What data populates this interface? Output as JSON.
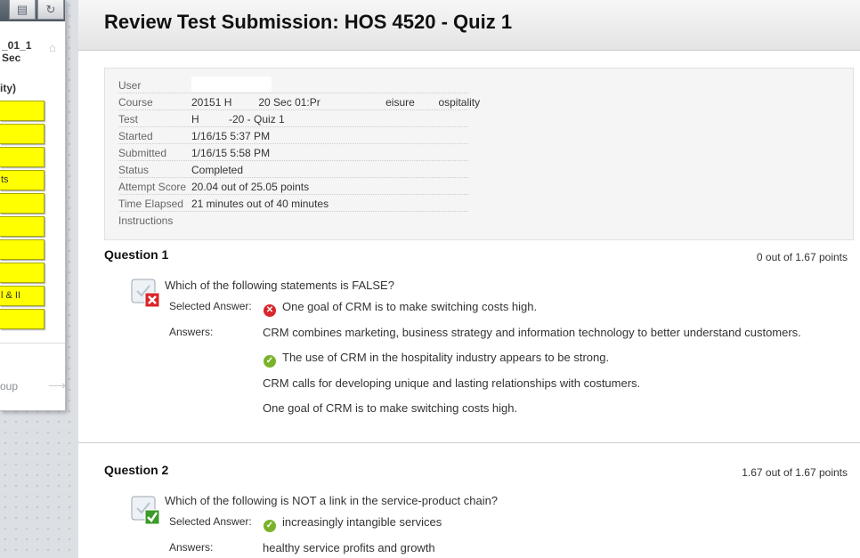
{
  "menu": {
    "course_title_line1": "_01_1",
    "course_title_line2": "Sec",
    "course_sub": "ity)",
    "buttons": [
      {
        "label": ""
      },
      {
        "label": ""
      },
      {
        "label": ""
      },
      {
        "label": "ts"
      },
      {
        "label": ""
      },
      {
        "label": ""
      },
      {
        "label": ""
      },
      {
        "label": ""
      },
      {
        "label": "l & II"
      },
      {
        "label": ""
      }
    ],
    "group_label": "oup"
  },
  "page": {
    "title": "Review Test Submission: HOS 4520 - Quiz 1"
  },
  "summary": {
    "rows": [
      {
        "label": "User",
        "value": ""
      },
      {
        "label": "Course",
        "value": "20151 H         20 Sec 01:Pr                      eisure        ospitality"
      },
      {
        "label": "Test",
        "value": "H          -20 - Quiz 1"
      },
      {
        "label": "Started",
        "value": "1/16/15 5:37 PM"
      },
      {
        "label": "Submitted",
        "value": "1/16/15 5:58 PM"
      },
      {
        "label": "Status",
        "value": "Completed"
      },
      {
        "label": "Attempt Score",
        "value": "20.04 out of 25.05 points"
      },
      {
        "label": "Time Elapsed",
        "value": "21 minutes out of 40 minutes"
      },
      {
        "label": "Instructions",
        "value": ""
      }
    ]
  },
  "questions": [
    {
      "heading": "Question 1",
      "points": "0 out of 1.67 points",
      "text": "Which of the following statements is FALSE?",
      "selected_label": "Selected Answer:",
      "selected_answer": "One goal of CRM is to make switching costs high.",
      "answers_label": "Answers:",
      "answers": [
        "CRM combines marketing, business strategy and information technology to better understand customers.",
        "The use of CRM in the hospitality industry appears to be strong.",
        "CRM calls for developing unique and lasting relationships with costumers.",
        "One goal of CRM is to make switching costs high."
      ]
    },
    {
      "heading": "Question 2",
      "points": "1.67 out of 1.67 points",
      "text": "Which of the following is NOT a link in the service-product chain?",
      "selected_label": "Selected Answer:",
      "selected_answer": "increasingly intangible services",
      "answers_label": "Answers:",
      "answers": [
        "healthy service profits and growth"
      ]
    }
  ],
  "colors": {
    "menu_button": "#ffff00",
    "wrong": "#d9262b",
    "right": "#7ab32a"
  }
}
